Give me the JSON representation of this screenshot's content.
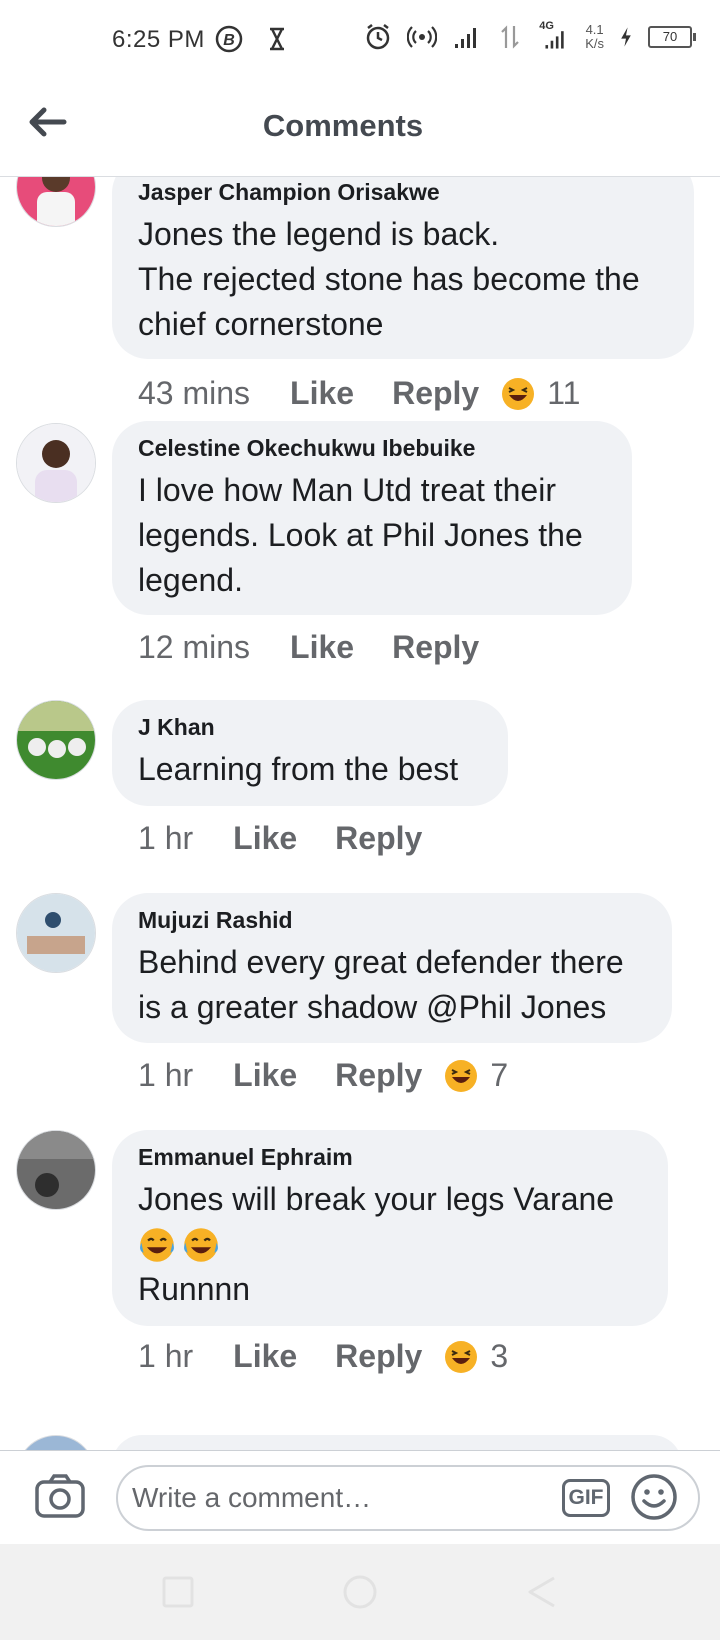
{
  "status_bar": {
    "time": "6:25 PM",
    "network": "4G",
    "speed_value": "4.1",
    "speed_unit": "K/s",
    "battery": "70"
  },
  "header": {
    "title": "Comments"
  },
  "comments": [
    {
      "author": "Jasper Champion Orisakwe",
      "text": "Jones the legend is back.\nThe rejected stone has become the chief cornerstone",
      "time": "43 mins",
      "like": "Like",
      "reply": "Reply",
      "reaction_count": "11"
    },
    {
      "author": "Celestine Okechukwu Ibebuike",
      "text": "I love how Man Utd treat their legends. Look at Phil Jones the legend.",
      "time": "12 mins",
      "like": "Like",
      "reply": "Reply"
    },
    {
      "author": "J Khan",
      "text": "Learning from the best",
      "time": "1 hr",
      "like": "Like",
      "reply": "Reply"
    },
    {
      "author": "Mujuzi Rashid",
      "text": "Behind every great defender there is a greater shadow @Phil Jones",
      "time": "1 hr",
      "like": "Like",
      "reply": "Reply",
      "reaction_count": "7"
    },
    {
      "author": "Emmanuel Ephraim",
      "text": "Jones will break your legs Varane",
      "text2": "Runnnn",
      "time": "1 hr",
      "like": "Like",
      "reply": "Reply",
      "reaction_count": "3"
    }
  ],
  "composer": {
    "placeholder": "Write a comment…",
    "gif_label": "GIF"
  },
  "colors": {
    "bubble": "#f0f2f5",
    "secondary_text": "#65676b",
    "nav_bar": "#f1f1f1"
  }
}
